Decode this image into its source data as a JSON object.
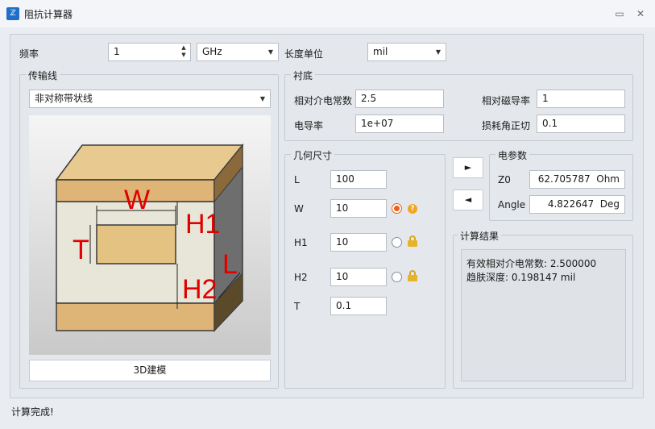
{
  "window": {
    "title": "阻抗计算器",
    "app_icon": "app-logo-icon",
    "buttons": [
      "chat-icon",
      "close-icon"
    ]
  },
  "frequency": {
    "label": "频率",
    "value": "1",
    "unit": "GHz"
  },
  "length_unit": {
    "label": "长度单位",
    "value": "mil"
  },
  "transmission_line": {
    "title": "传输线",
    "type": "非对称带状线",
    "model_button": "3D建模",
    "diagram_labels": {
      "W": "W",
      "H1": "H1",
      "H2": "H2",
      "T": "T",
      "L": "L"
    }
  },
  "substrate": {
    "title": "衬底",
    "dk_label": "相对介电常数",
    "dk_value": "2.5",
    "mu_label": "相对磁导率",
    "mu_value": "1",
    "cond_label": "电导率",
    "cond_value": "1e+07",
    "tand_label": "损耗角正切",
    "tand_value": "0.1"
  },
  "geometry": {
    "title": "几何尺寸",
    "rows": [
      {
        "label": "L",
        "value": "100"
      },
      {
        "label": "W",
        "value": "10"
      },
      {
        "label": "H1",
        "value": "10"
      },
      {
        "label": "H2",
        "value": "10"
      },
      {
        "label": "T",
        "value": "0.1"
      }
    ]
  },
  "arrows": {
    "forward": "►",
    "backward": "◄"
  },
  "electrical": {
    "title": "电参数",
    "z0_label": "Z0",
    "z0_value": "62.705787",
    "z0_unit": "Ohm",
    "angle_label": "Angle",
    "angle_value": "4.822647",
    "angle_unit": "Deg"
  },
  "results": {
    "title": "计算结果",
    "line1": "有效相对介电常数: 2.500000",
    "line2": "趋肤深度: 0.198147 mil"
  },
  "status": "计算完成!"
}
